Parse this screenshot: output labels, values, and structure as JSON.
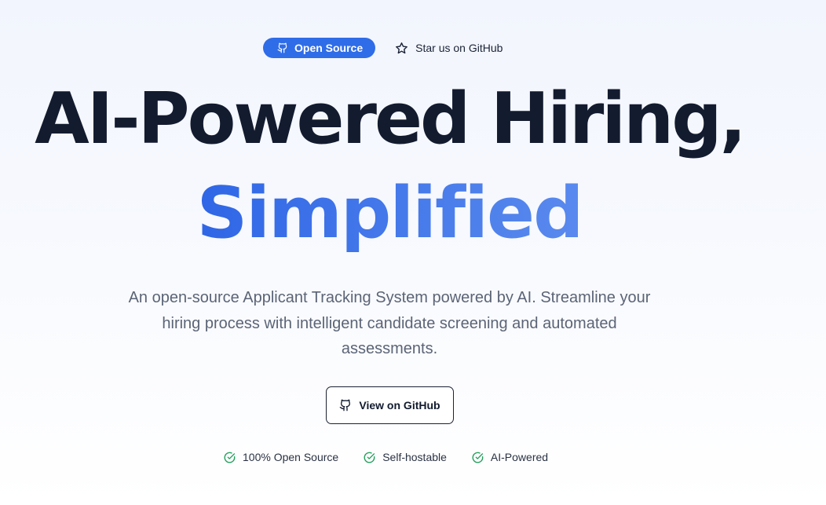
{
  "top_bar": {
    "badge_label": "Open Source",
    "badge_icon": "github-icon",
    "star_label": "Star us on GitHub",
    "star_icon": "star-icon"
  },
  "hero": {
    "headline_line1": "AI-Powered Hiring,",
    "headline_line2": "Simplified",
    "subtitle": "An open-source Applicant Tracking System powered by AI. Streamline your hiring process with intelligent candidate screening and automated assessments.",
    "cta_label": "View on GitHub",
    "cta_icon": "github-icon"
  },
  "features": [
    {
      "label": "100% Open Source",
      "icon": "check-circle-icon"
    },
    {
      "label": "Self-hostable",
      "icon": "check-circle-icon"
    },
    {
      "label": "AI-Powered",
      "icon": "check-circle-icon"
    }
  ],
  "colors": {
    "accent": "#2f6ce8",
    "gradient_start": "#2f66e6",
    "gradient_end": "#5a8aee",
    "headline": "#131b2f",
    "subtitle": "#5b6476",
    "check": "#22a05a"
  }
}
